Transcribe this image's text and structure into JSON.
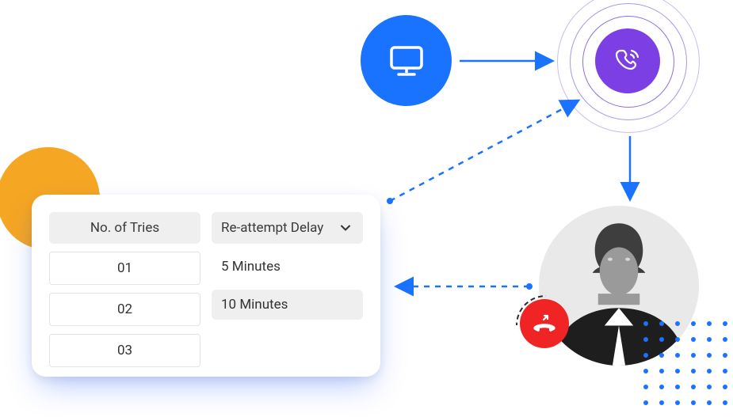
{
  "card": {
    "tries_header": "No. of Tries",
    "delay_header": "Re-attempt Delay",
    "tries": [
      "01",
      "02",
      "03"
    ],
    "delay_options": [
      "5 Minutes",
      "10 Minutes"
    ],
    "selected_delay_index": 1
  },
  "icons": {
    "computer": "monitor-icon",
    "phone": "phone-ringing-icon",
    "missed": "missed-call-icon",
    "avatar": "person-avatar"
  },
  "colors": {
    "blue": "#1A73FF",
    "purple": "#7B3FE4",
    "orange": "#F5A623",
    "red": "#F02424",
    "grey": "#E9E9E9"
  },
  "flows": [
    {
      "from": "computer",
      "to": "phone",
      "style": "solid"
    },
    {
      "from": "phone",
      "to": "avatar",
      "style": "solid"
    },
    {
      "from": "avatar",
      "to": "card",
      "style": "dashed"
    },
    {
      "from": "card",
      "to": "phone",
      "style": "dashed"
    }
  ]
}
